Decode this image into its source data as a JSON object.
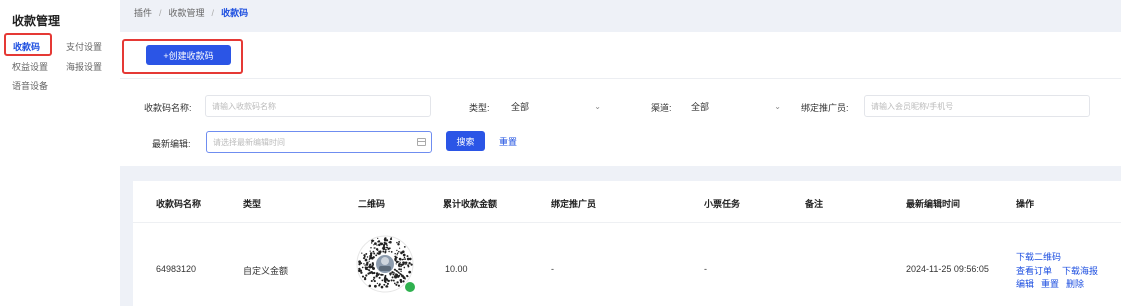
{
  "sidebar": {
    "title": "收款管理",
    "items": [
      {
        "label": "收款码"
      },
      {
        "label": "支付设置"
      },
      {
        "label": "权益设置"
      },
      {
        "label": "海报设置"
      },
      {
        "label": "语音设备"
      }
    ]
  },
  "breadcrumb": [
    "插件",
    "收款管理",
    "收款码"
  ],
  "toolbar": {
    "create_label": "+创建收款码"
  },
  "filters": {
    "name_label": "收款码名称:",
    "name_placeholder": "请输入收款码名称",
    "type_label": "类型:",
    "type_value": "全部",
    "channel_label": "渠道:",
    "channel_value": "全部",
    "promoter_label": "绑定推广员:",
    "promoter_placeholder": "请输入会员昵称/手机号",
    "edit_label": "最新编辑:",
    "edit_placeholder": "请选择最新编辑时间",
    "search_label": "搜索",
    "reset_label": "重置"
  },
  "table": {
    "columns": [
      "收款码名称",
      "类型",
      "二维码",
      "累计收款金额",
      "绑定推广员",
      "小票任务",
      "备注",
      "最新编辑时间",
      "操作"
    ],
    "rows": [
      {
        "name": "64983120",
        "type": "自定义金额",
        "amount": "10.00",
        "promoter": "-",
        "receipt_task": "-",
        "remark": "",
        "edited": "2024-11-25 09:56:05",
        "actions": [
          "下载二维码",
          "查看订单",
          "下载海报",
          "编辑",
          "重置",
          "删除"
        ]
      }
    ]
  },
  "colors": {
    "accent": "#2b55e6",
    "highlight_box": "#e53935",
    "qr_badge": "#2fb14f"
  },
  "icons": [
    "chevron-down-icon",
    "calendar-icon",
    "qr-code-icon",
    "mini-program-icon"
  ]
}
